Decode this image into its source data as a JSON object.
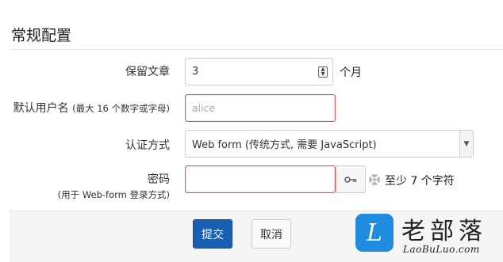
{
  "section": {
    "title": "常规配置"
  },
  "form": {
    "retain": {
      "label": "保留文章",
      "value": "3",
      "unit": "个月"
    },
    "username": {
      "label": "默认用户名",
      "label_hint": "(最大 16 个数字或字母)",
      "placeholder": "alice"
    },
    "auth": {
      "label": "认证方式",
      "selected": "Web form (传统方式, 需要 JavaScript)"
    },
    "password": {
      "label": "密码",
      "label_hint": "(用于 Web-form 登录方式)",
      "hint": "至少 7 个字符"
    }
  },
  "buttons": {
    "submit": "提交",
    "cancel": "取消"
  },
  "watermark": {
    "name": "老部落",
    "url": "LaoBuLuo.com",
    "logo_glyph": "L"
  },
  "icons": {
    "spin": "spinner-arrows-icon",
    "select": "chevron-down-icon",
    "key": "key-icon",
    "hint": "lifebuoy-icon"
  },
  "colors": {
    "accent": "#1b5fb5",
    "error_border": "#e55353",
    "watermark_blue": "#1e8ce0"
  }
}
